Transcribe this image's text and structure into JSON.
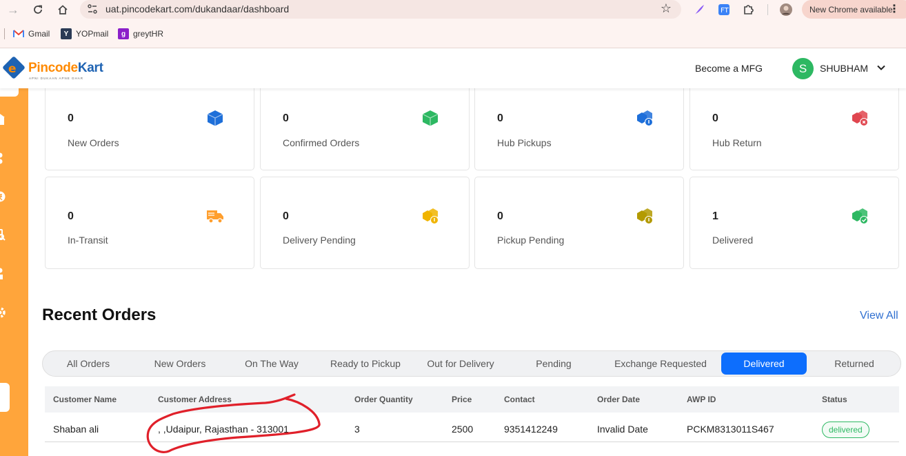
{
  "browser": {
    "url": "uat.pincodekart.com/dukandaar/dashboard",
    "new_chrome_label": "New Chrome available",
    "menu_glyph": "⋮",
    "bookmarks": [
      {
        "label": "Gmail"
      },
      {
        "label": "YOPmail"
      },
      {
        "label": "greytHR"
      }
    ]
  },
  "header": {
    "logo_text_main": "Pincode",
    "logo_text_accent": "Kart",
    "logo_tagline": "APNI DUKAAN APNE GHAR",
    "become_mfg": "Become a MFG",
    "avatar_initial": "S",
    "user_name": "SHUBHAM"
  },
  "stats": [
    {
      "count": "0",
      "label": "New Orders",
      "icon": "box-icon",
      "color": "#1e6fd9"
    },
    {
      "count": "0",
      "label": "Confirmed Orders",
      "icon": "box-icon",
      "color": "#2db862"
    },
    {
      "count": "0",
      "label": "Hub Pickups",
      "icon": "boxes-info-icon",
      "color": "#1e6fd9"
    },
    {
      "count": "0",
      "label": "Hub Return",
      "icon": "boxes-return-icon",
      "color": "#e0464f"
    },
    {
      "count": "0",
      "label": "In-Transit",
      "icon": "truck-icon",
      "color": "#ff9f2e"
    },
    {
      "count": "0",
      "label": "Delivery Pending",
      "icon": "boxes-pending-icon",
      "color": "#f0b400"
    },
    {
      "count": "0",
      "label": "Pickup Pending",
      "icon": "boxes-pending-icon",
      "color": "#b39a00"
    },
    {
      "count": "1",
      "label": "Delivered",
      "icon": "boxes-check-icon",
      "color": "#2db862"
    }
  ],
  "recent_orders": {
    "title": "Recent Orders",
    "view_all": "View All",
    "tabs": [
      {
        "label": "All Orders",
        "active": false
      },
      {
        "label": "New Orders",
        "active": false
      },
      {
        "label": "On The Way",
        "active": false
      },
      {
        "label": "Ready to Pickup",
        "active": false
      },
      {
        "label": "Out for Delivery",
        "active": false
      },
      {
        "label": "Pending",
        "active": false
      },
      {
        "label": "Exchange Requested",
        "active": false
      },
      {
        "label": "Delivered",
        "active": true
      },
      {
        "label": "Returned",
        "active": false
      }
    ],
    "columns": [
      "Customer Name",
      "Customer Address",
      "Order Quantity",
      "Price",
      "Contact",
      "Order Date",
      "AWP ID",
      "Status"
    ],
    "rows": [
      {
        "customer_name": "Shaban ali",
        "customer_address": ", ,Udaipur, Rajasthan - 313001",
        "order_quantity": "3",
        "price": "2500",
        "contact": "9351412249",
        "order_date": "Invalid Date",
        "awp_id": "PCKM8313011S467",
        "status": "delivered"
      }
    ]
  },
  "colors": {
    "sidebar": "#ffa53b",
    "accent_blue": "#0d6efd",
    "status_green": "#2db862",
    "annotation_red": "#e0202a"
  }
}
